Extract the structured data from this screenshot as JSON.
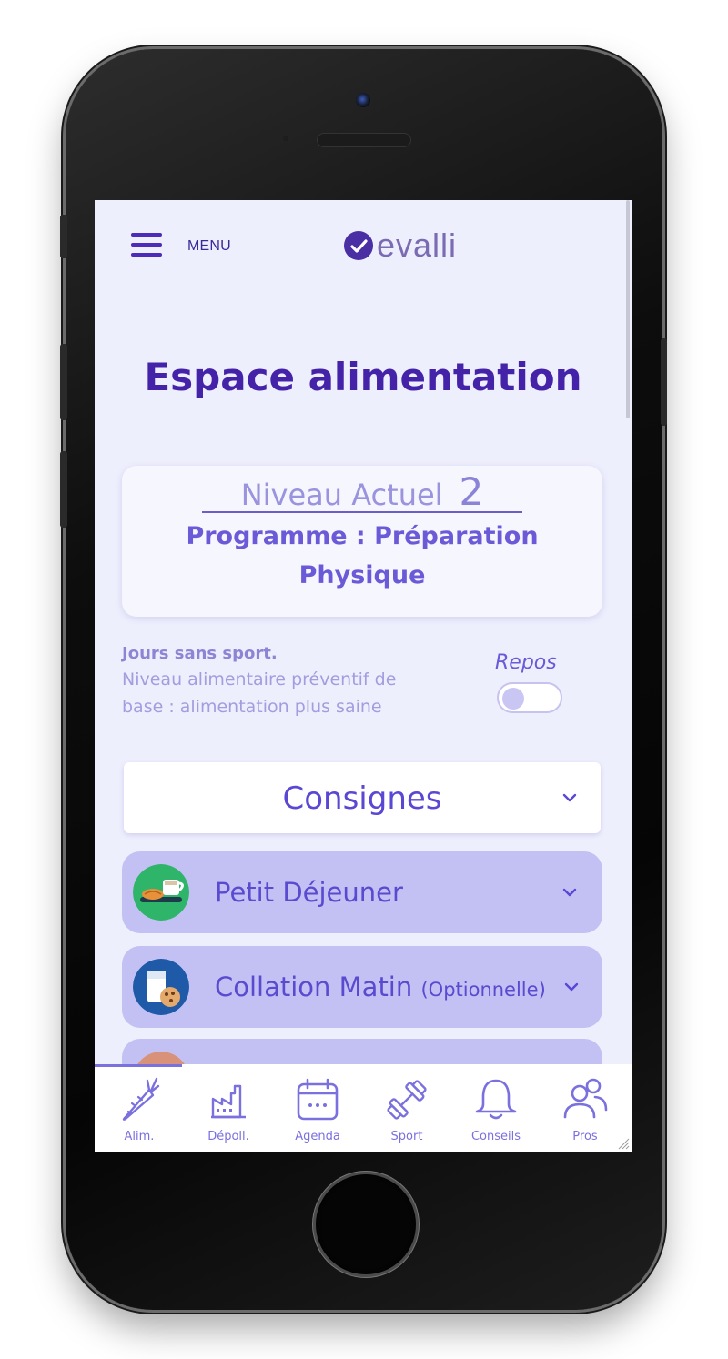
{
  "header": {
    "menu_label": "MENU",
    "logo_text": "evalli"
  },
  "page": {
    "title": "Espace alimentation"
  },
  "level_card": {
    "level_label": "Niveau Actuel",
    "level_value": "2",
    "program_line1": "Programme : Préparation",
    "program_line2": "Physique"
  },
  "rest_day": {
    "title": "Jours sans sport.",
    "desc_line1": "Niveau alimentaire préventif de",
    "desc_line2": "base : alimentation plus saine",
    "toggle_label": "Repos",
    "toggle_on": false
  },
  "consignes": {
    "label": "Consignes"
  },
  "meals": [
    {
      "label": "Petit Déjeuner",
      "suffix": "",
      "icon": "breakfast-icon"
    },
    {
      "label": "Collation Matin ",
      "suffix": "(Optionnelle)",
      "icon": "milk-cookie-icon"
    },
    {
      "label": "",
      "suffix": "",
      "icon": "meal-icon"
    }
  ],
  "bottom_nav": [
    {
      "label": "Alim.",
      "icon": "carrot-icon",
      "active": true
    },
    {
      "label": "Dépoll.",
      "icon": "factory-icon",
      "active": false
    },
    {
      "label": "Agenda",
      "icon": "calendar-icon",
      "active": false
    },
    {
      "label": "Sport",
      "icon": "dumbbell-icon",
      "active": false
    },
    {
      "label": "Conseils",
      "icon": "bell-icon",
      "active": false
    },
    {
      "label": "Pros",
      "icon": "users-icon",
      "active": false
    }
  ],
  "colors": {
    "primary": "#4423a8",
    "accent": "#5a47d4",
    "screen_bg": "#eeeffd",
    "meal_bg": "#c3c0f4",
    "nav_accent": "#7a70de"
  }
}
